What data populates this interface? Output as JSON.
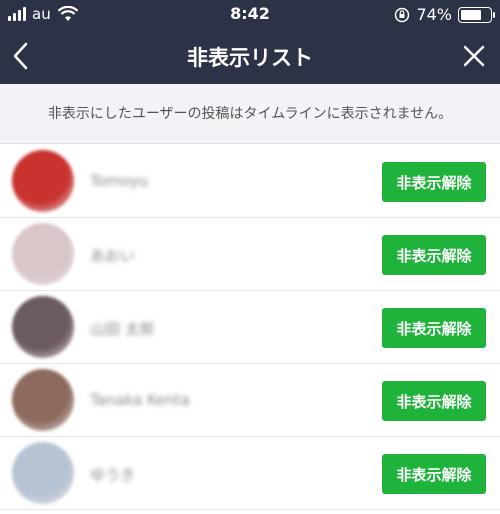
{
  "status": {
    "carrier": "au",
    "time": "8:42",
    "battery_percent": "74%",
    "battery_level": 0.74
  },
  "header": {
    "title": "非表示リスト"
  },
  "notice": {
    "text": "非表示にしたユーザーの投稿はタイムラインに表示されません。"
  },
  "hidden_users": [
    {
      "name": "Tomoyu",
      "avatar_color": "#c8322f",
      "button_label": "非表示解除"
    },
    {
      "name": "あおい",
      "avatar_color": "#d8c6c9",
      "button_label": "非表示解除"
    },
    {
      "name": "山田 太郎",
      "avatar_color": "#6b5a5e",
      "button_label": "非表示解除"
    },
    {
      "name": "Tanaka Kenta",
      "avatar_color": "#8c6a5e",
      "button_label": "非表示解除"
    },
    {
      "name": "ゆうき",
      "avatar_color": "#b6c3d3",
      "button_label": "非表示解除"
    }
  ]
}
